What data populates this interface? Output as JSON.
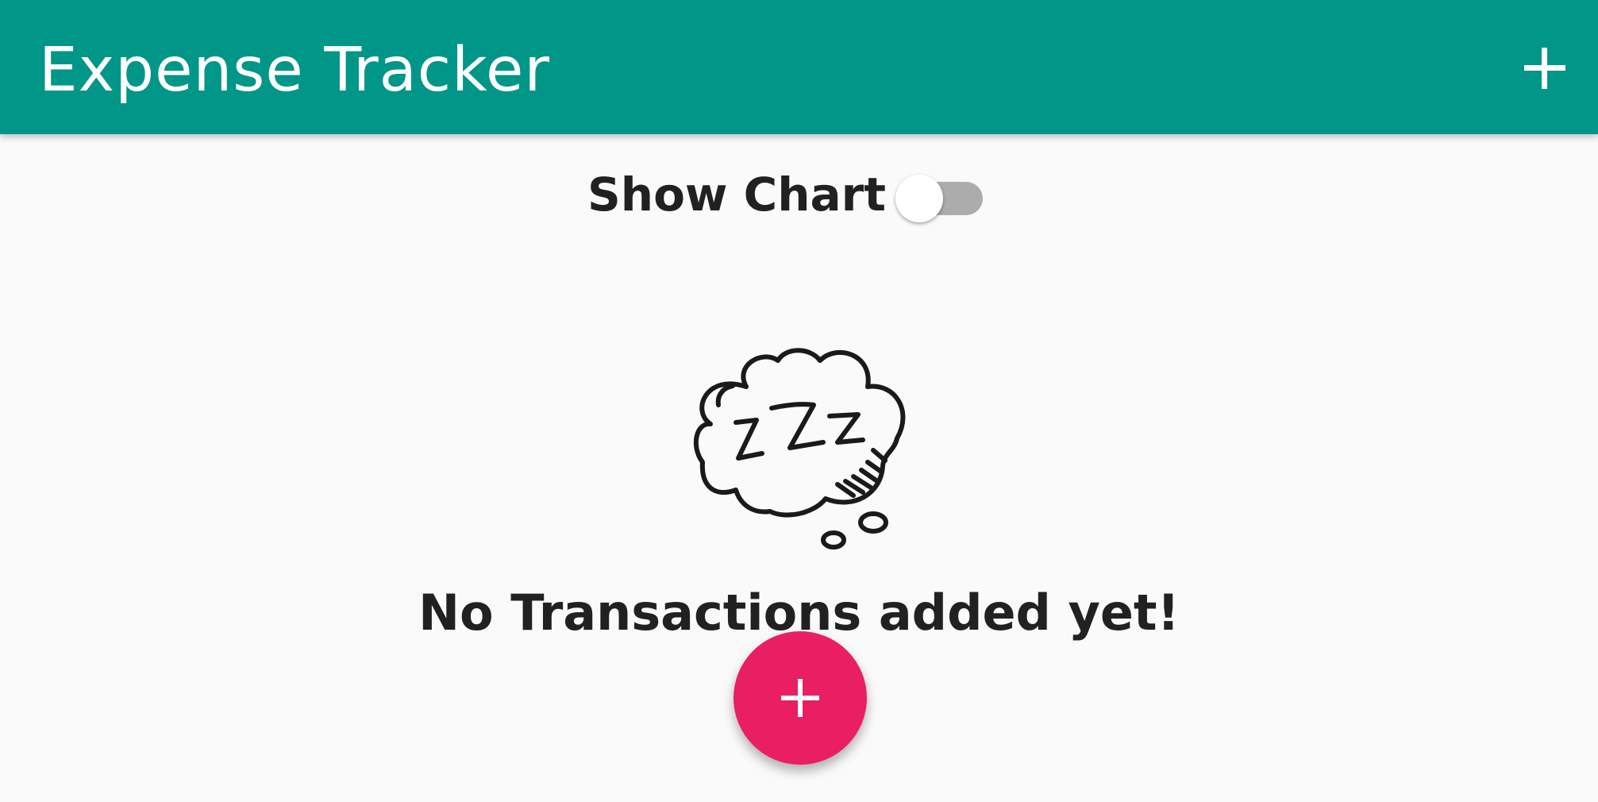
{
  "app_bar": {
    "title": "Expense Tracker",
    "add_icon": "plus-icon",
    "background_color": "#009688"
  },
  "chart_toggle": {
    "label": "Show Chart",
    "checked": false
  },
  "empty_state": {
    "illustration": "sleeping-zzz-cloud",
    "message": "No Transactions added yet!"
  },
  "fab": {
    "icon": "plus-icon",
    "color": "#e91e63"
  }
}
